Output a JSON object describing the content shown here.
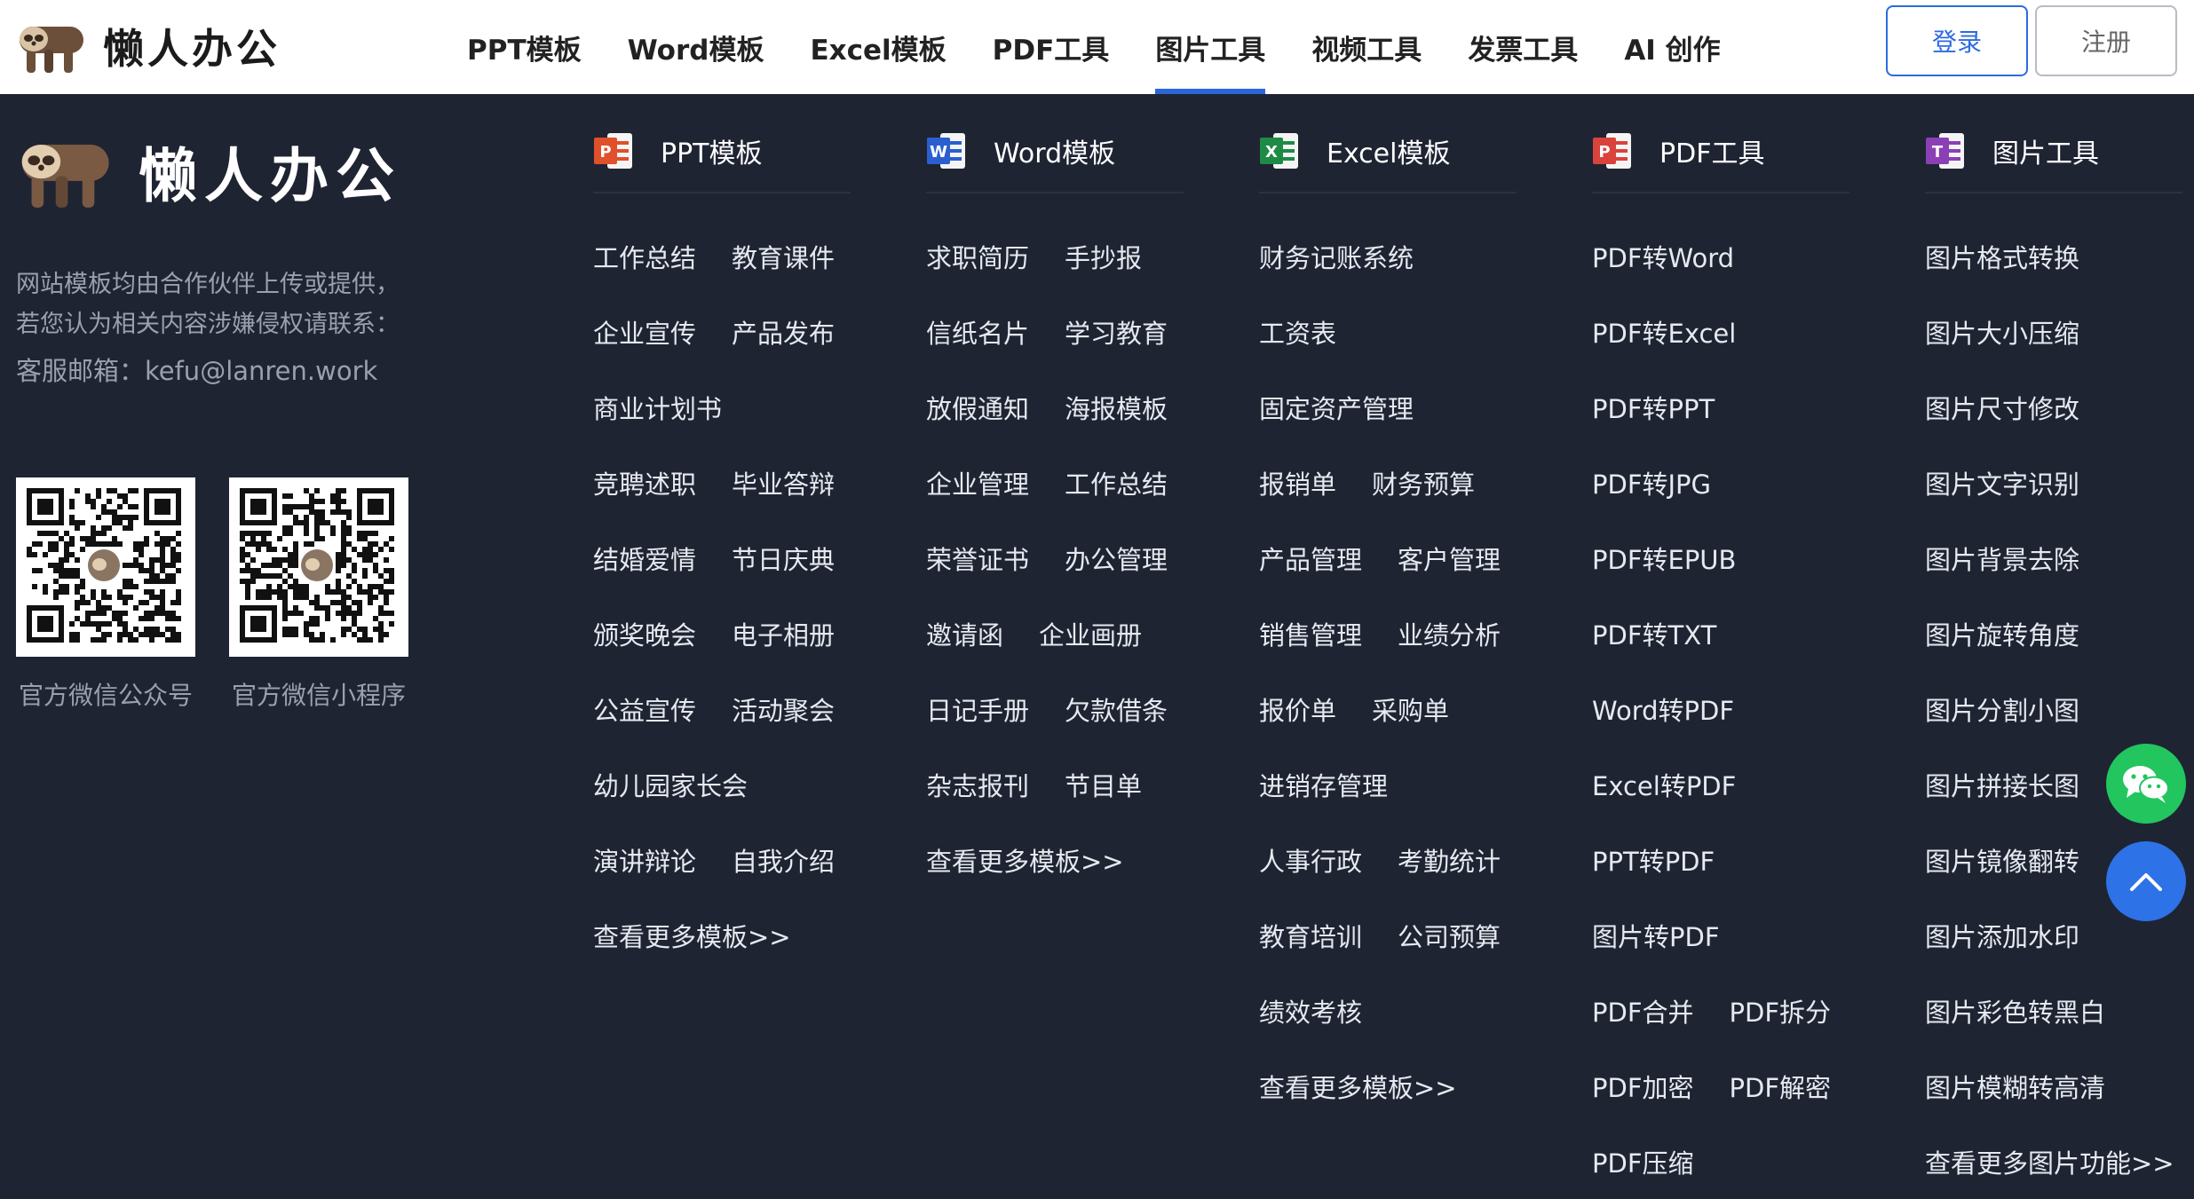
{
  "header": {
    "logo_text": "懒人办公",
    "nav": [
      {
        "label": "PPT模板"
      },
      {
        "label": "Word模板"
      },
      {
        "label": "Excel模板"
      },
      {
        "label": "PDF工具"
      },
      {
        "label": "图片工具",
        "active": true
      },
      {
        "label": "视频工具"
      },
      {
        "label": "发票工具"
      },
      {
        "label": "AI 创作"
      }
    ],
    "login_label": "登录",
    "register_label": "注册"
  },
  "footer": {
    "logo_text": "懒人办公",
    "desc_line1": "网站模板均由合作伙伴上传或提供，",
    "desc_line2": "若您认为相关内容涉嫌侵权请联系：",
    "email_line": "客服邮箱：kefu@lanren.work",
    "qr_left_caption": "官方微信公众号",
    "qr_right_caption": "官方微信小程序",
    "columns": [
      {
        "title": "PPT模板",
        "icon": "ppt-file-icon",
        "color": "#e0502a",
        "letter": "P",
        "rows": [
          [
            "工作总结",
            "教育课件"
          ],
          [
            "企业宣传",
            "产品发布"
          ],
          [
            "商业计划书"
          ],
          [
            "竞聘述职",
            "毕业答辩"
          ],
          [
            "结婚爱情",
            "节日庆典"
          ],
          [
            "颁奖晚会",
            "电子相册"
          ],
          [
            "公益宣传",
            "活动聚会"
          ],
          [
            "幼儿园家长会"
          ],
          [
            "演讲辩论",
            "自我介绍"
          ],
          [
            "查看更多模板>>"
          ]
        ]
      },
      {
        "title": "Word模板",
        "icon": "word-file-icon",
        "color": "#2b5fcf",
        "letter": "W",
        "rows": [
          [
            "求职简历",
            "手抄报"
          ],
          [
            "信纸名片",
            "学习教育"
          ],
          [
            "放假通知",
            "海报模板"
          ],
          [
            "企业管理",
            "工作总结"
          ],
          [
            "荣誉证书",
            "办公管理"
          ],
          [
            "邀请函",
            "企业画册"
          ],
          [
            "日记手册",
            "欠款借条"
          ],
          [
            "杂志报刊",
            "节目单"
          ],
          [
            "查看更多模板>>"
          ]
        ]
      },
      {
        "title": "Excel模板",
        "icon": "excel-file-icon",
        "color": "#1e8a46",
        "letter": "X",
        "rows": [
          [
            "财务记账系统"
          ],
          [
            "工资表"
          ],
          [
            "固定资产管理"
          ],
          [
            "报销单",
            "财务预算"
          ],
          [
            "产品管理",
            "客户管理"
          ],
          [
            "销售管理",
            "业绩分析"
          ],
          [
            "报价单",
            "采购单"
          ],
          [
            "进销存管理"
          ],
          [
            "人事行政",
            "考勤统计"
          ],
          [
            "教育培训",
            "公司预算"
          ],
          [
            "绩效考核"
          ],
          [
            "查看更多模板>>"
          ]
        ]
      },
      {
        "title": "PDF工具",
        "icon": "pdf-file-icon",
        "color": "#d9433b",
        "letter": "P",
        "rows": [
          [
            "PDF转Word"
          ],
          [
            "PDF转Excel"
          ],
          [
            "PDF转PPT"
          ],
          [
            "PDF转JPG"
          ],
          [
            "PDF转EPUB"
          ],
          [
            "PDF转TXT"
          ],
          [
            "Word转PDF"
          ],
          [
            "Excel转PDF"
          ],
          [
            "PPT转PDF"
          ],
          [
            "图片转PDF"
          ],
          [
            "PDF合并",
            "PDF拆分"
          ],
          [
            "PDF加密",
            "PDF解密"
          ],
          [
            "PDF压缩"
          ]
        ]
      },
      {
        "title": "图片工具",
        "icon": "image-file-icon",
        "color": "#8b3fb5",
        "letter": "T",
        "rows": [
          [
            "图片格式转换"
          ],
          [
            "图片大小压缩"
          ],
          [
            "图片尺寸修改"
          ],
          [
            "图片文字识别"
          ],
          [
            "图片背景去除"
          ],
          [
            "图片旋转角度"
          ],
          [
            "图片分割小图"
          ],
          [
            "图片拼接长图"
          ],
          [
            "图片镜像翻转"
          ],
          [
            "图片添加水印"
          ],
          [
            "图片彩色转黑白"
          ],
          [
            "图片模糊转高清"
          ],
          [
            "查看更多图片功能>>"
          ]
        ]
      }
    ]
  },
  "floating": {
    "wechat_icon": "wechat-icon",
    "top_icon": "chevron-up-icon"
  }
}
